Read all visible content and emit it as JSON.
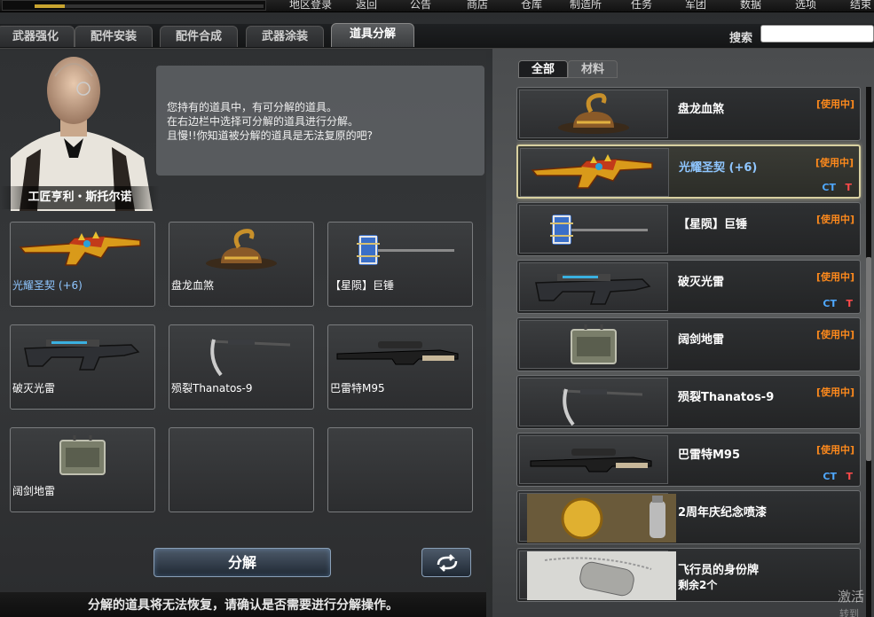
{
  "top": {
    "level_label": "",
    "xp_progress": 0.13,
    "nav": [
      "地区登录",
      "返回",
      "公告",
      "商店",
      "仓库",
      "制造所",
      "任务",
      "军团",
      "数据",
      "选项",
      "结束"
    ]
  },
  "tabs": [
    "武器强化",
    "配件安装",
    "配件合成",
    "武器涂装",
    "道具分解"
  ],
  "active_tab": "道具分解",
  "search": {
    "label": "搜索",
    "value": "",
    "placeholder": ""
  },
  "npc": {
    "name": "工匠亨利・斯托尔诺",
    "dialog": [
      "您持有的道具中，有可分解的道具。",
      "在右边栏中选择可分解的道具进行分解。",
      "且慢!!你知道被分解的道具是无法复原的吧?"
    ]
  },
  "slots": [
    {
      "label": "光耀圣契 (+6)",
      "icon": "rifle-gold-icon",
      "highlight": true
    },
    {
      "label": "盘龙血煞",
      "icon": "dragon-hat-icon",
      "highlight": false
    },
    {
      "label": "【星陨】巨锤",
      "icon": "hammer-icon",
      "highlight": false
    },
    {
      "label": "破灭光雷",
      "icon": "heavy-gun-icon",
      "highlight": false
    },
    {
      "label": "殒裂Thanatos-9",
      "icon": "scythe-icon",
      "highlight": false
    },
    {
      "label": "巴雷特M95",
      "icon": "sniper-icon",
      "highlight": false
    },
    {
      "label": "阔剑地雷",
      "icon": "mine-icon",
      "highlight": false
    },
    {
      "label": "",
      "icon": "",
      "highlight": false
    },
    {
      "label": "",
      "icon": "",
      "highlight": false
    }
  ],
  "decompose_label": "分解",
  "footer_note": "分解的道具将无法恢复，请确认是否需要进行分解操作。",
  "right_tabs": [
    "全部",
    "材料"
  ],
  "inventory": [
    {
      "name": "盘龙血煞",
      "status": "[使用中]",
      "ct": "",
      "t": "",
      "sub": "",
      "icon": "dragon-hat-icon",
      "selected": false,
      "blue": false
    },
    {
      "name": "光耀圣契 (+6)",
      "status": "[使用中]",
      "ct": "CT",
      "t": "T",
      "sub": "",
      "icon": "rifle-gold-icon",
      "selected": true,
      "blue": true
    },
    {
      "name": "【星陨】巨锤",
      "status": "[使用中]",
      "ct": "",
      "t": "",
      "sub": "",
      "icon": "hammer-icon",
      "selected": false,
      "blue": false
    },
    {
      "name": "破灭光雷",
      "status": "[使用中]",
      "ct": "CT",
      "t": "T",
      "sub": "",
      "icon": "heavy-gun-icon",
      "selected": false,
      "blue": false
    },
    {
      "name": "阔剑地雷",
      "status": "[使用中]",
      "ct": "",
      "t": "",
      "sub": "",
      "icon": "mine-icon",
      "selected": false,
      "blue": false
    },
    {
      "name": "殒裂Thanatos-9",
      "status": "[使用中]",
      "ct": "",
      "t": "",
      "sub": "",
      "icon": "scythe-icon",
      "selected": false,
      "blue": false
    },
    {
      "name": "巴雷特M95",
      "status": "[使用中]",
      "ct": "CT",
      "t": "T",
      "sub": "",
      "icon": "sniper-icon",
      "selected": false,
      "blue": false
    },
    {
      "name": "2周年庆纪念喷漆",
      "status": "",
      "ct": "",
      "t": "",
      "sub": "",
      "icon": "spray-coin-icon",
      "selected": false,
      "blue": false
    },
    {
      "name": "飞行员的身份牌",
      "status": "",
      "ct": "",
      "t": "",
      "sub": "剩余2个",
      "icon": "dog-tag-icon",
      "selected": false,
      "blue": false
    }
  ],
  "watermark": [
    "激活",
    "转到"
  ],
  "colors": {
    "in_use": "#ff8a1c",
    "ct": "#4fa8ff",
    "t": "#ff4a4a",
    "selected_border": "#d8d0a0",
    "highlight_text": "#8fc6ff"
  }
}
